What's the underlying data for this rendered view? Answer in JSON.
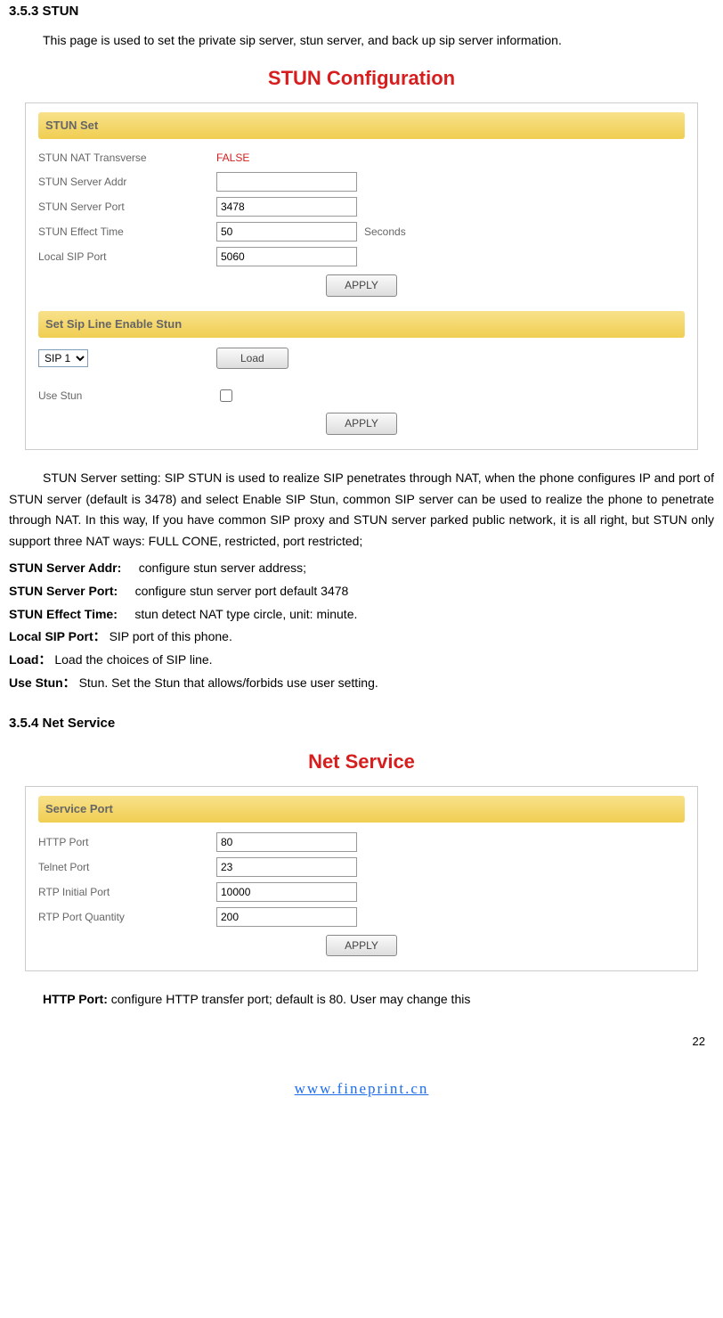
{
  "h353": {
    "title": "3.5.3 STUN",
    "intro": "This page is used to set the private sip server, stun server, and back up sip server information."
  },
  "stunconf": {
    "heading": "STUN Configuration",
    "section1": {
      "title": "STUN Set",
      "row1_label": "STUN NAT Transverse",
      "row1_value": "FALSE",
      "row2_label": "STUN Server Addr",
      "row2_value": "",
      "row3_label": "STUN Server Port",
      "row3_value": "3478",
      "row4_label": "STUN Effect Time",
      "row4_value": "50",
      "row4_suffix": "Seconds",
      "row5_label": "Local SIP Port",
      "row5_value": "5060",
      "apply_btn": "APPLY"
    },
    "section2": {
      "title": "Set Sip Line Enable Stun",
      "select_value": "SIP 1",
      "load_btn": "Load",
      "row1_label": "Use Stun",
      "apply_btn": "APPLY"
    }
  },
  "stun_desc": "STUN Server setting: SIP STUN is used to realize SIP penetrates through NAT, when the phone configures IP and port of STUN server (default is 3478) and select Enable SIP Stun, common SIP server can be used to realize the phone to penetrate through NAT. In this way, If you have common SIP proxy and STUN server parked public network, it is all right, but STUN only support three NAT ways: FULL CONE, restricted, port restricted;",
  "defs": {
    "d1_label": "STUN Server Addr:",
    "d1_text": "configure stun server address;",
    "d2_label": "STUN Server Port:",
    "d2_text": "configure stun server port default 3478",
    "d3_label": "STUN Effect Time:",
    "d3_text": "stun detect NAT type circle, unit: minute.",
    "d4_label": "Local SIP Port：",
    "d4_text": "SIP port of this phone.",
    "d5_label": "Load：",
    "d5_text": "Load the choices of SIP line.",
    "d6_label": "Use Stun：",
    "d6_text": "Stun. Set the Stun that allows/forbids use user setting."
  },
  "h354": {
    "title": "3.5.4 Net Service"
  },
  "netsvc": {
    "heading": "Net Service",
    "section": {
      "title": "Service Port",
      "row1_label": "HTTP Port",
      "row1_value": "80",
      "row2_label": "Telnet Port",
      "row2_value": "23",
      "row3_label": "RTP Initial Port",
      "row3_value": "10000",
      "row4_label": "RTP Port Quantity",
      "row4_value": "200",
      "apply_btn": "APPLY"
    }
  },
  "http_desc_label": "HTTP Port:",
  "http_desc_text": " configure HTTP transfer port; default is 80. User may change this",
  "pagenum": "22",
  "footer_link_text": "www.fineprint.cn"
}
